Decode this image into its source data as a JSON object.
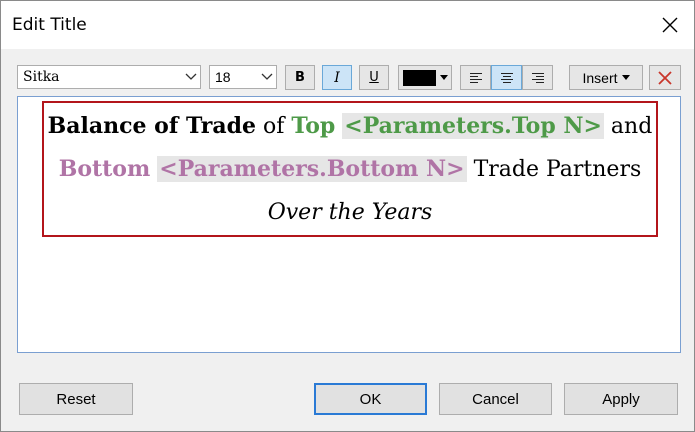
{
  "window": {
    "title": "Edit Title"
  },
  "toolbar": {
    "font": "Sitka",
    "size": "18",
    "bold_label": "B",
    "italic_label": "I",
    "underline_label": "U",
    "text_color": "#000000",
    "insert_label": "Insert",
    "active_states": {
      "italic": true,
      "align_center": true
    }
  },
  "editor": {
    "line1": {
      "t1": "Balance of Trade",
      "t2": " of ",
      "t3": "Top",
      "t4": "<Parameters.Top N>",
      "t5": " and"
    },
    "line2": {
      "t1": "Bottom",
      "t2": "<Parameters.Bottom N>",
      "t3": " Trade Partners"
    },
    "line3": {
      "t1": "Over the Years"
    },
    "colors": {
      "top": "#4e9a48",
      "bottom": "#b074a6",
      "border": "#b3151b"
    }
  },
  "footer": {
    "reset_label": "Reset",
    "ok_label": "OK",
    "cancel_label": "Cancel",
    "apply_label": "Apply"
  },
  "icons": {
    "close": "close-icon",
    "align_left": "align-left-icon",
    "align_center": "align-center-icon",
    "align_right": "align-right-icon",
    "clear": "clear-x-icon"
  }
}
